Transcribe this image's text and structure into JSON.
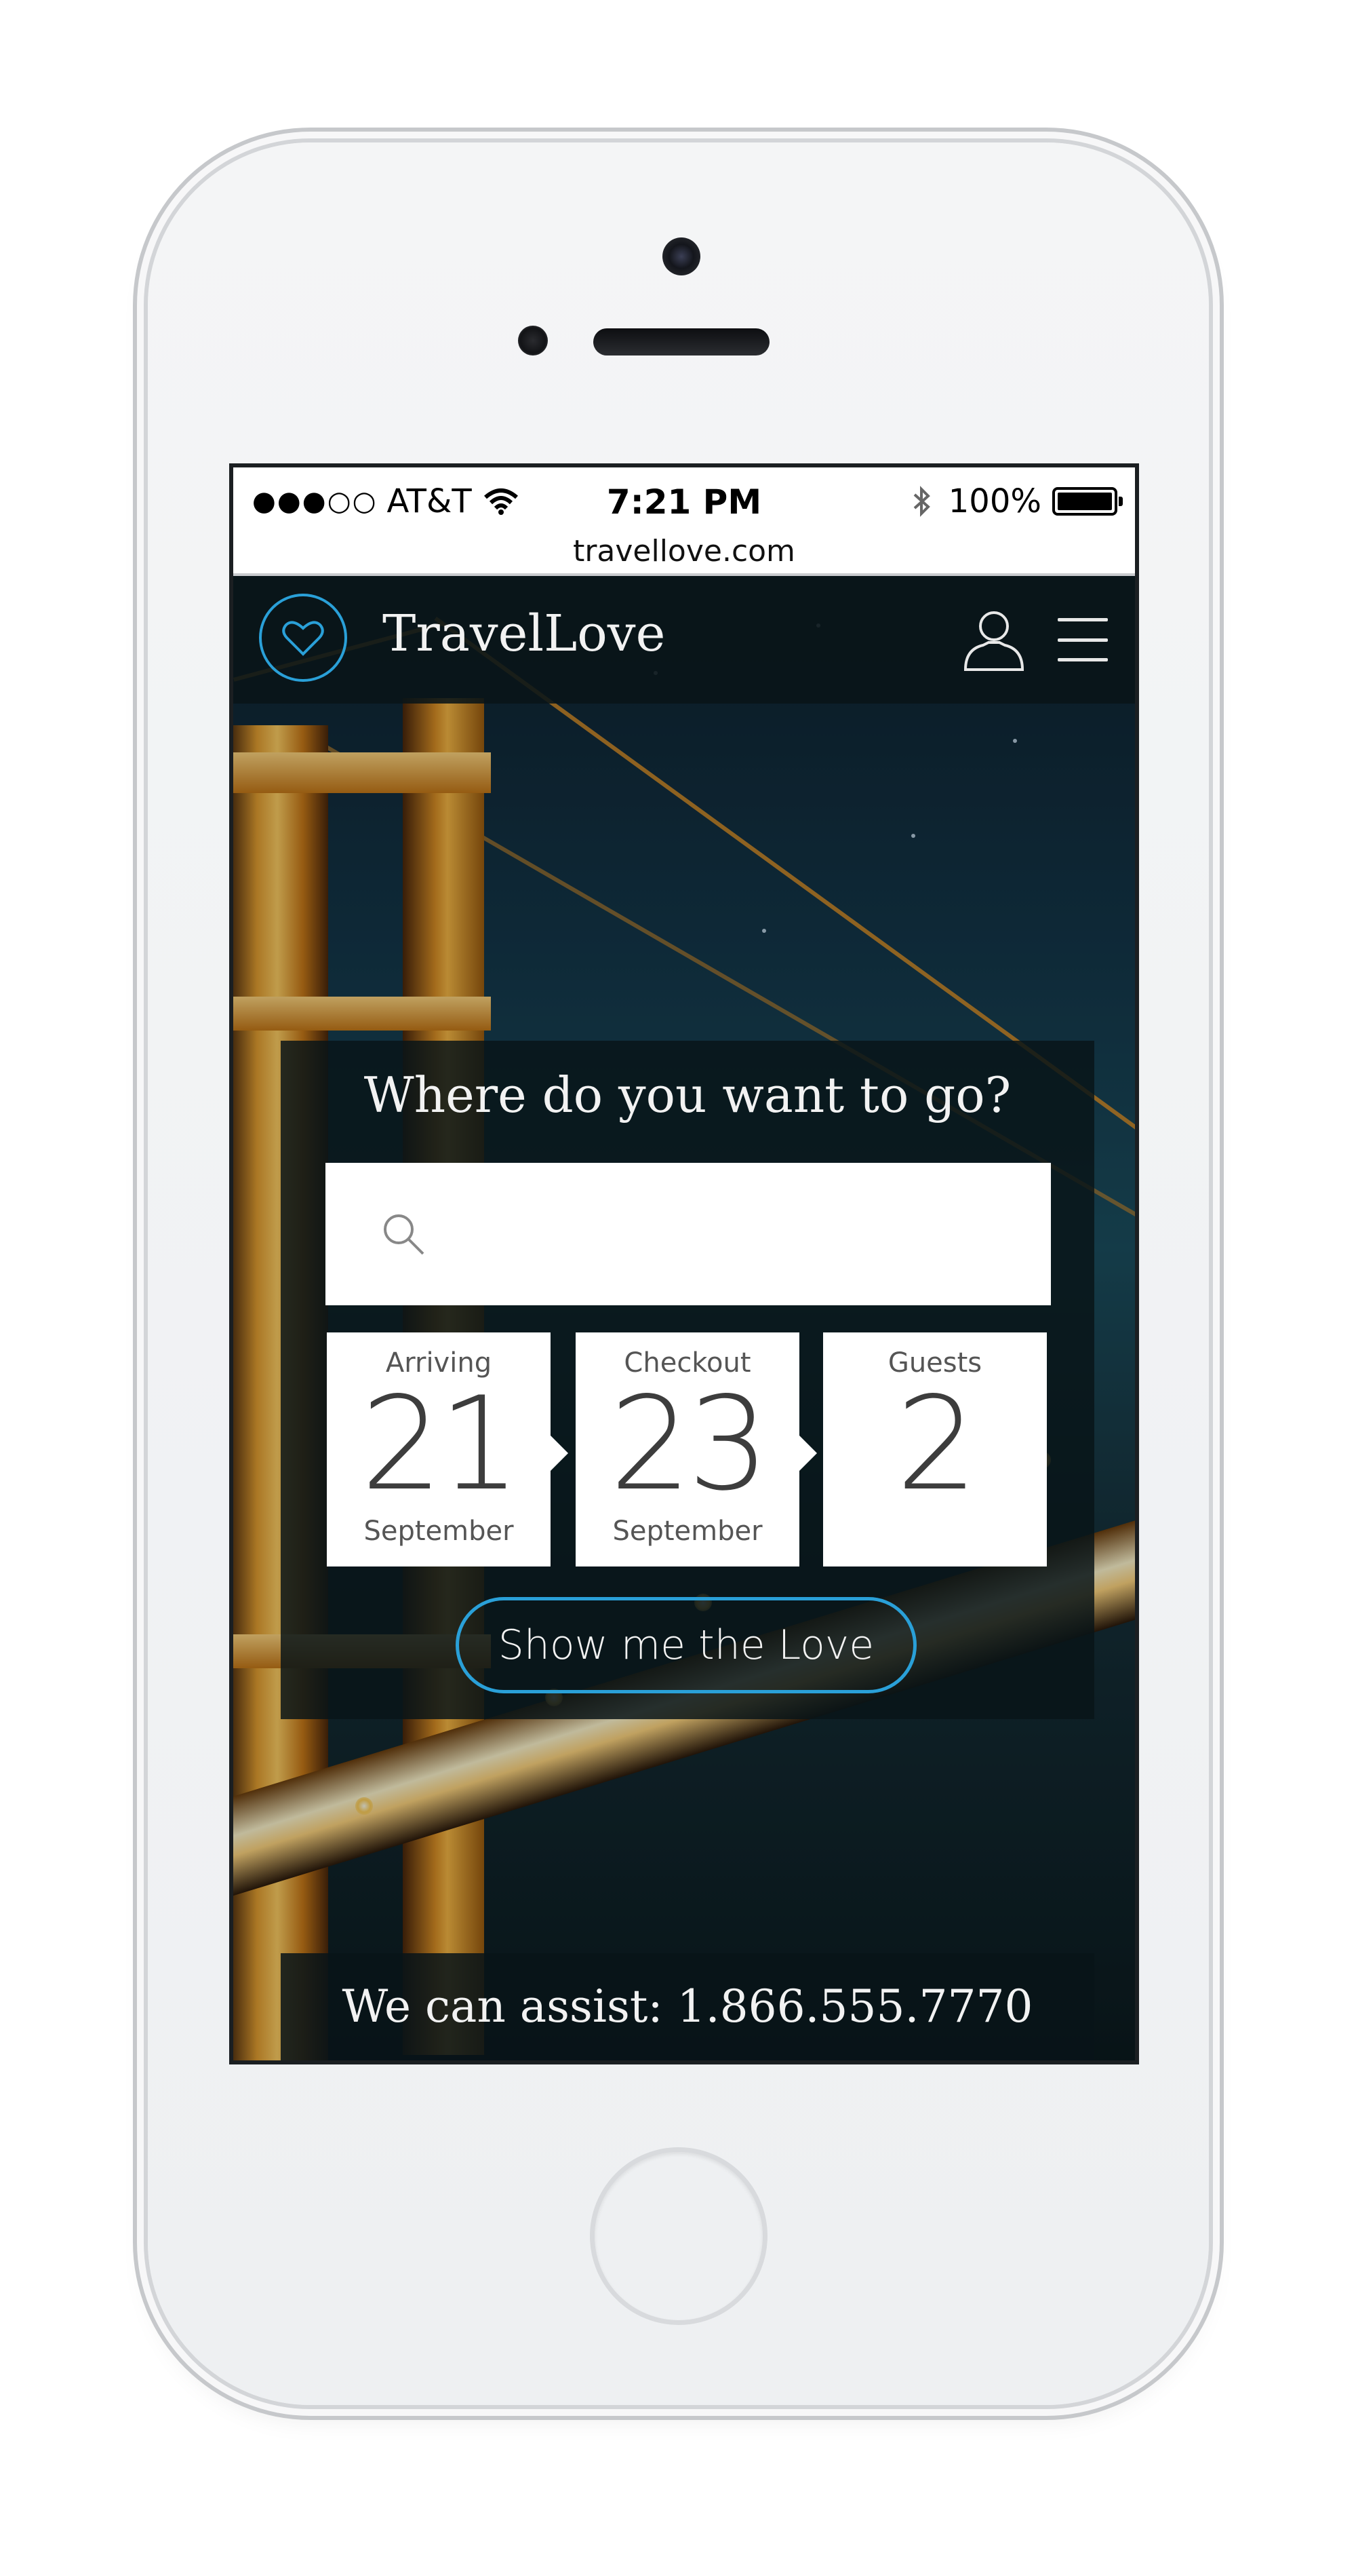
{
  "status_bar": {
    "signal_dots": "●●●○○",
    "carrier": "AT&T",
    "time": "7:21 PM",
    "bluetooth_icon": "bluetooth-icon",
    "battery": "100%",
    "battery_level": 1.0,
    "url": "travellove.com"
  },
  "navbar": {
    "brand": "TravelLove",
    "logo_icon": "heart-icon",
    "user_icon": "user-icon",
    "menu_icon": "hamburger-menu-icon"
  },
  "search": {
    "title": "Where do you want to go?",
    "placeholder": "",
    "search_icon": "search-icon"
  },
  "dates": {
    "arriving": {
      "label": "Arriving",
      "day": "21",
      "month": "September"
    },
    "checkout": {
      "label": "Checkout",
      "day": "23",
      "month": "September"
    },
    "guests": {
      "label": "Guests",
      "count": "2"
    }
  },
  "cta": {
    "label": "Show me the Love"
  },
  "assist": {
    "text": "We can assist:  1.866.555.7770"
  },
  "colors": {
    "accent": "#2aa0d8",
    "panel": "#081418",
    "background_night": "#123244"
  }
}
